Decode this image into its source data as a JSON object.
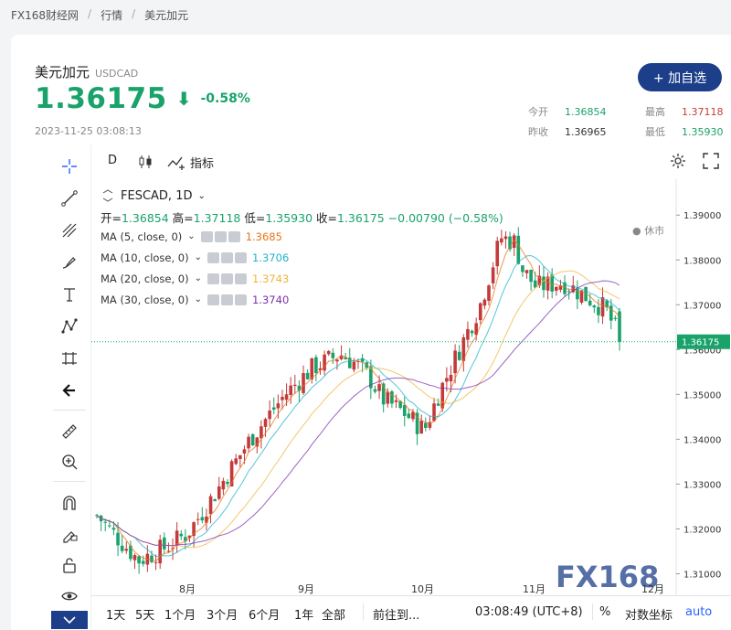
{
  "breadcrumb": [
    "FX168财经网",
    "行情",
    "美元加元"
  ],
  "header": {
    "name_cn": "美元加元",
    "code": "USDCAD",
    "price": "1.36175",
    "change_pct": "-0.58%",
    "timestamp": "2023-11-25 03:08:13",
    "add_button": "+ 加自选"
  },
  "quotes": {
    "open_label": "今开",
    "open": "1.36854",
    "high_label": "最高",
    "high": "1.37118",
    "prev_label": "昨收",
    "prev": "1.36965",
    "low_label": "最低",
    "low": "1.35930"
  },
  "toolbar": {
    "interval": "D",
    "indicators_label": "指标"
  },
  "legend": {
    "symbol": "FESCAD, 1D",
    "ohlc_open_label": "开=",
    "ohlc_open": "1.36854",
    "ohlc_high_label": "高=",
    "ohlc_high": "1.37118",
    "ohlc_low_label": "低=",
    "ohlc_low": "1.35930",
    "ohlc_close_label": "收=",
    "ohlc_close": "1.36175",
    "ohlc_change": "−0.00790 (−0.58%)",
    "market_status": "休市",
    "ma": [
      {
        "label": "MA (5, close, 0)",
        "value": "1.3685",
        "color": "#e8731a"
      },
      {
        "label": "MA (10, close, 0)",
        "value": "1.3706",
        "color": "#1fb2c8"
      },
      {
        "label": "MA (20, close, 0)",
        "value": "1.3743",
        "color": "#f0b43a"
      },
      {
        "label": "MA (30, close, 0)",
        "value": "1.3740",
        "color": "#7a2fb0"
      }
    ]
  },
  "chart_data": {
    "type": "candlestick",
    "y_ticks": [
      "1.39000",
      "1.38000",
      "1.37000",
      "1.36000",
      "1.35000",
      "1.34000",
      "1.33000",
      "1.32000",
      "1.31000"
    ],
    "ylim": [
      1.305,
      1.398
    ],
    "x_ticks": [
      "8月",
      "9月",
      "10月",
      "11月",
      "12月"
    ],
    "last_price_label": "1.36175",
    "last_close": 1.36175,
    "watermark": "FX168",
    "up_color": "#19a36b",
    "down_color": "#c43a3a"
  },
  "bottom": {
    "ranges": [
      "1天",
      "5天",
      "1个月",
      "3个月",
      "6个月",
      "1年",
      "全部"
    ],
    "goto": "前往到...",
    "clock": "03:08:49 (UTC+8)",
    "pct": "%",
    "log": "对数坐标",
    "auto": "auto"
  }
}
